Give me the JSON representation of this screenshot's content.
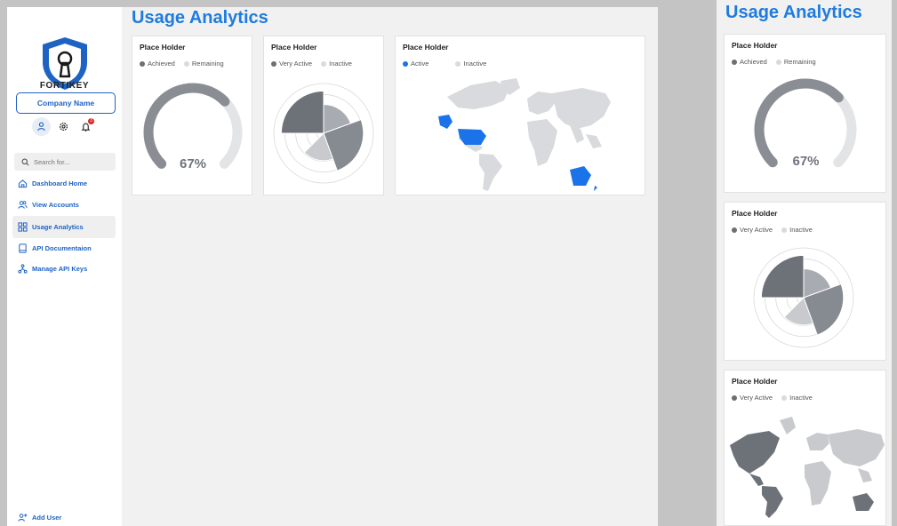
{
  "app": {
    "brand": "FORTIKEY",
    "company_button": "Company Name",
    "notification_count": "3"
  },
  "search": {
    "placeholder": "Search for..."
  },
  "nav": {
    "items": [
      {
        "label": "Dashboard Home",
        "icon": "home-icon"
      },
      {
        "label": "View Accounts",
        "icon": "users-icon"
      },
      {
        "label": "Usage Analytics",
        "icon": "grid-icon",
        "active": true
      },
      {
        "label": "API Documentaion",
        "icon": "book-icon"
      },
      {
        "label": "Manage API Keys",
        "icon": "network-icon"
      }
    ],
    "add_user": "Add User"
  },
  "page": {
    "title": "Usage Analytics"
  },
  "cards": [
    {
      "title": "Place Holder",
      "legend": [
        "Achieved",
        "Remaining"
      ]
    },
    {
      "title": "Place Holder",
      "legend": [
        "Very Active",
        "Inactive"
      ]
    },
    {
      "title": "Place Holder",
      "legend": [
        "Active",
        "Inactive"
      ]
    }
  ],
  "mobile": {
    "title": "Usage Analytics",
    "cards": [
      {
        "title": "Place Holder",
        "legend": [
          "Achieved",
          "Remaining"
        ]
      },
      {
        "title": "Place Holder",
        "legend": [
          "Very Active",
          "Inactive"
        ]
      },
      {
        "title": "Place Holder",
        "legend": [
          "Very Active",
          "Inactive"
        ]
      }
    ]
  },
  "chart_data": [
    {
      "type": "gauge",
      "series": [
        {
          "name": "Achieved",
          "value": 67
        },
        {
          "name": "Remaining",
          "value": 33
        }
      ],
      "label": "67%"
    },
    {
      "type": "polar-area",
      "slices": [
        {
          "name": "Very Active",
          "value": 0.85,
          "start": 270,
          "end": 360,
          "color": "#6d7178"
        },
        {
          "name": "segment-2",
          "value": 0.58,
          "start": 0,
          "end": 70,
          "color": "#a8abb1"
        },
        {
          "name": "segment-3",
          "value": 0.8,
          "start": 70,
          "end": 160,
          "color": "#868a91"
        },
        {
          "name": "Inactive",
          "value": 0.55,
          "start": 160,
          "end": 225,
          "color": "#c8cacd"
        }
      ]
    },
    {
      "type": "map",
      "series": [
        {
          "name": "Active",
          "regions": [
            "United States",
            "Alaska",
            "Australia",
            "New Zealand"
          ]
        },
        {
          "name": "Inactive"
        }
      ]
    }
  ],
  "colors": {
    "accent": "#1e7be0",
    "nav_blue": "#1e63c4",
    "gauge_achieved": "#8a8d93",
    "gauge_remaining": "#e3e4e6",
    "legend_achieved": "#6b6f76",
    "legend_remaining": "#dadada",
    "map_active": "#1a73e8",
    "map_land": "#d8dadd"
  }
}
